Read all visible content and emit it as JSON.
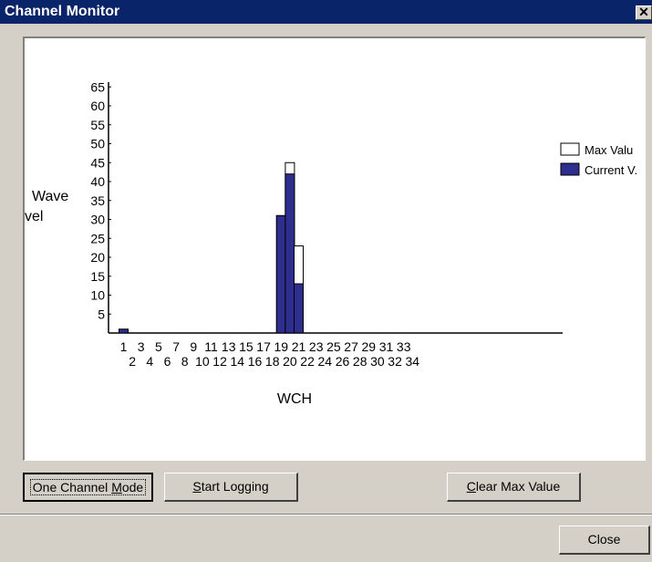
{
  "window": {
    "title": "Channel Monitor",
    "close_glyph": "✕"
  },
  "chart_data": {
    "type": "bar",
    "xlabel": "WCH",
    "ylabel_line1": "Wave",
    "ylabel_line2": "vel",
    "ylim": [
      0,
      65
    ],
    "yticks": [
      5,
      10,
      15,
      20,
      25,
      30,
      35,
      40,
      45,
      50,
      55,
      60,
      65
    ],
    "categories": [
      "1",
      "2",
      "3",
      "4",
      "5",
      "6",
      "7",
      "8",
      "9",
      "10",
      "11",
      "12",
      "13",
      "14",
      "15",
      "16",
      "17",
      "18",
      "19",
      "20",
      "21",
      "22",
      "23",
      "24",
      "25",
      "26",
      "27",
      "28",
      "29",
      "30",
      "31",
      "32",
      "33",
      "34"
    ],
    "series": [
      {
        "name": "Max Value",
        "color": "#ffffff",
        "values": [
          1,
          0,
          0,
          0,
          0,
          0,
          0,
          0,
          0,
          0,
          0,
          0,
          0,
          0,
          0,
          0,
          0,
          0,
          31,
          45,
          23,
          0,
          0,
          0,
          0,
          0,
          0,
          0,
          0,
          0,
          0,
          0,
          0,
          0
        ]
      },
      {
        "name": "Current V.",
        "color": "#2e2e8f",
        "values": [
          1,
          0,
          0,
          0,
          0,
          0,
          0,
          0,
          0,
          0,
          0,
          0,
          0,
          0,
          0,
          0,
          0,
          0,
          31,
          42,
          13,
          0,
          0,
          0,
          0,
          0,
          0,
          0,
          0,
          0,
          0,
          0,
          0,
          0
        ]
      }
    ],
    "legend": {
      "position": "right",
      "labels": [
        "Max Valu",
        "Current V."
      ]
    },
    "grid": false
  },
  "buttons": {
    "one_channel_a": "One Channel ",
    "one_channel_key": "M",
    "one_channel_b": "ode",
    "start_key": "S",
    "start_rest": "tart Logging",
    "clear_key": "C",
    "clear_rest": "lear Max Value",
    "close": "Close"
  }
}
